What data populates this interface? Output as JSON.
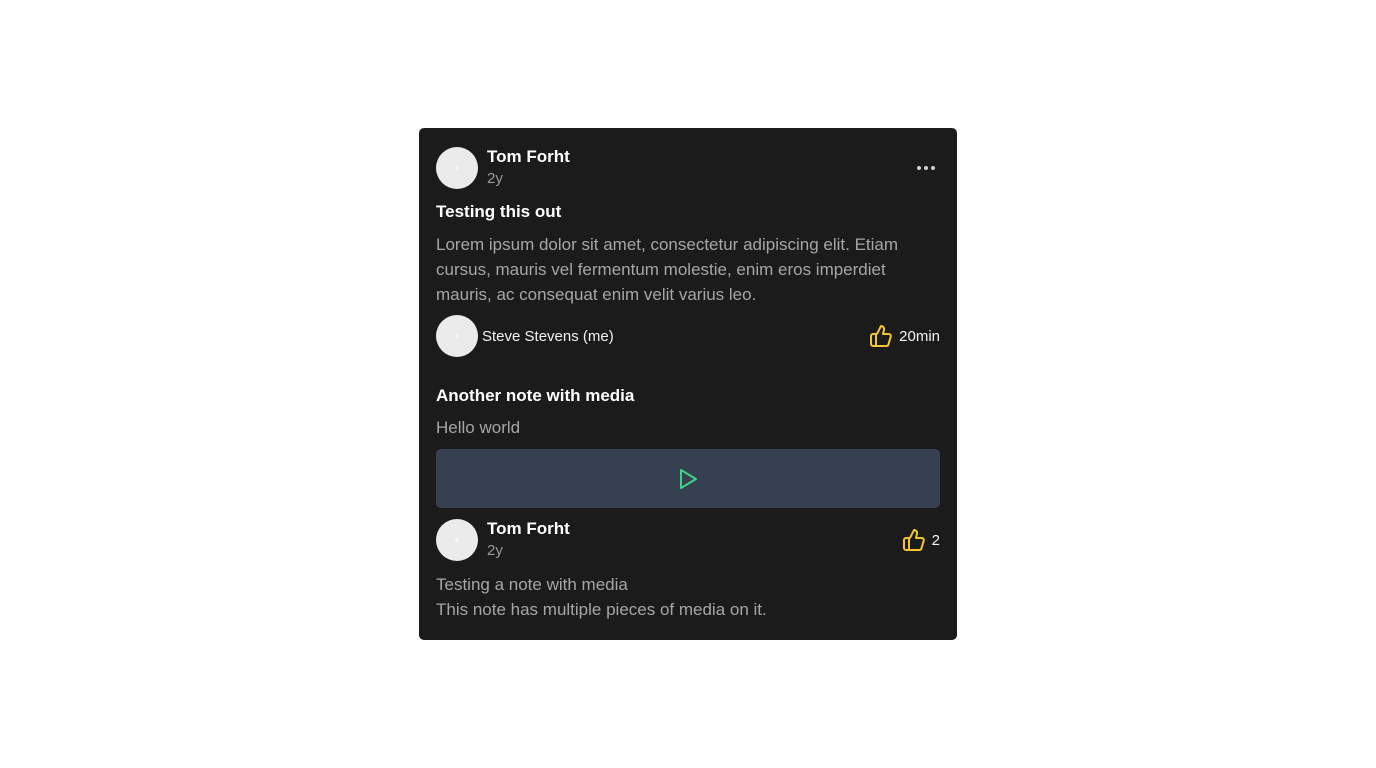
{
  "post": {
    "author": "Tom Forht",
    "time": "2y",
    "note1": {
      "title": "Testing this out",
      "body": "Lorem ipsum dolor sit amet, consectetur adipiscing elit. Etiam cursus, mauris vel fermentum molestie, enim eros imperdiet mauris, ac consequat enim velit varius leo.",
      "reply_author": "Steve Stevens (me)",
      "reply_time": "20min"
    },
    "note2": {
      "title": "Another note with media",
      "body": "Hello world",
      "media_icon": "play-icon"
    },
    "comment": {
      "author": "Tom Forht",
      "time": "2y",
      "likes": "2",
      "line1": "Testing a note with media",
      "line2": "This note has multiple pieces of media on it."
    }
  },
  "colors": {
    "card_bg": "#1b1b1b",
    "like_icon": "#f2c530",
    "play_icon": "#3fd08a",
    "media_bg": "#374051"
  }
}
